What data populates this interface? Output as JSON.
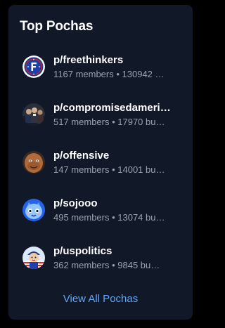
{
  "widget": {
    "title": "Top Pochas",
    "view_all_label": "View All Pochas"
  },
  "pochas": [
    {
      "name": "p/freethinkers",
      "stats": "1167 members • 130942 …",
      "avatar_icon": "freethinkers-logo-icon"
    },
    {
      "name": "p/compromisedameri…",
      "stats": "517 members • 17970 bu…",
      "avatar_icon": "group-photo-icon"
    },
    {
      "name": "p/offensive",
      "stats": "147 members • 14001 bu…",
      "avatar_icon": "face-photo-icon"
    },
    {
      "name": "p/sojooo",
      "stats": "495 members • 13074 bu…",
      "avatar_icon": "blue-cartoon-icon"
    },
    {
      "name": "p/uspolitics",
      "stats": "362 members • 9845 bu…",
      "avatar_icon": "patriotic-cartoon-icon"
    }
  ],
  "colors": {
    "page_background": "#000000",
    "card_background": "#111827",
    "title_text": "#ffffff",
    "secondary_text": "#9ca3af",
    "link": "#60a5fa"
  }
}
